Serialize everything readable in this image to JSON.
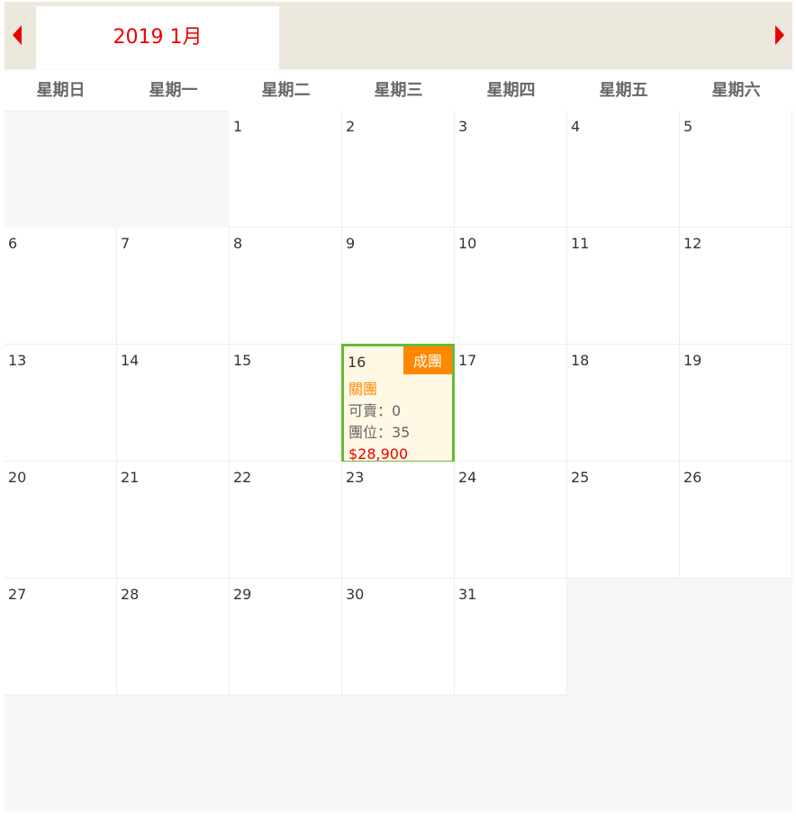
{
  "header": {
    "title": "2019 1月"
  },
  "weekdays": [
    "星期日",
    "星期一",
    "星期二",
    "星期三",
    "星期四",
    "星期五",
    "星期六"
  ],
  "first_weekday": 2,
  "days_in_month": 31,
  "event": {
    "day": 16,
    "badge": "成團",
    "status": "關團",
    "available": "可賣：0",
    "seats": "團位：35",
    "price": "$28,900"
  },
  "colors": {
    "accent": "#ee0000",
    "badge": "#ff8800",
    "selected_border": "#66bb33"
  }
}
